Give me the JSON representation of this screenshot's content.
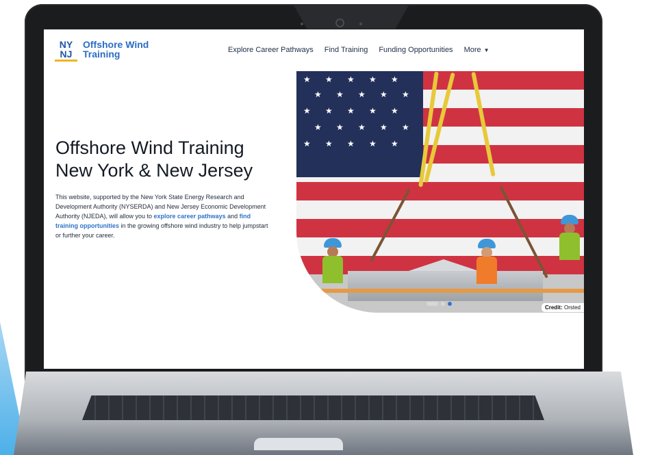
{
  "brand": {
    "mark_top": "NY",
    "mark_bottom": "NJ",
    "name_line1": "Offshore Wind",
    "name_line2": "Training"
  },
  "nav": {
    "links": [
      "Explore Career Pathways",
      "Find Training",
      "Funding Opportunities"
    ],
    "more": "More"
  },
  "hero": {
    "title_line1": "Offshore Wind Training",
    "title_line2": "New York & New Jersey",
    "description_before": "This website, supported by the New York State Energy Research and Development Authority (NYSERDA) and New Jersey Economic Development Authority (NJEDA), will allow you to ",
    "link_career": "explore career pathways",
    "description_middle": " and ",
    "link_training": "find training opportunities",
    "description_after": " in the growing offshore wind industry to help jumpstart or further your career."
  },
  "image": {
    "credit_label": "Credit:",
    "credit_value": "Orsted",
    "carousel_count": 3,
    "carousel_current": 3
  },
  "colors": {
    "brand_blue": "#2b6cc4",
    "nav_text": "#22314a",
    "link": "#2f73c8",
    "logo_gold": "#f0b321"
  }
}
